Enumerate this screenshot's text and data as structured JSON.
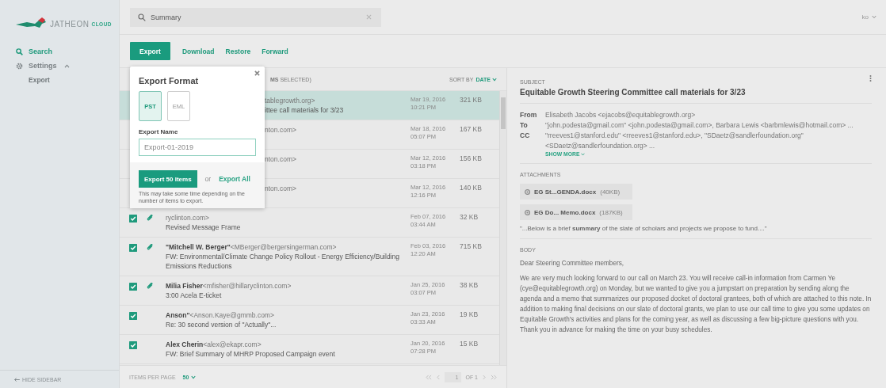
{
  "sidebar": {
    "logo": {
      "name": "JATHEON",
      "suffix": "CLOUD"
    },
    "nav": [
      {
        "kind": "search",
        "label": "Search",
        "selected": true
      },
      {
        "kind": "settings",
        "label": "Settings",
        "selected": false,
        "expanded": true,
        "children": [
          {
            "label": "Export",
            "selected": false
          }
        ]
      }
    ],
    "hide_sidebar": "HIDE SIDEBAR"
  },
  "search": {
    "value": "Summary"
  },
  "user": {
    "label": "ko"
  },
  "toolbar": [
    {
      "kind": "primary",
      "label": "Export"
    },
    {
      "kind": "link",
      "label": "Download"
    },
    {
      "kind": "link",
      "label": "Restore"
    },
    {
      "kind": "link",
      "label": "Forward"
    }
  ],
  "list": {
    "selection": "**MS** SELECTED)",
    "sort_label": "SORT BY",
    "sort_value": "DATE",
    "rows": [
      {
        "kind": "partial",
        "selected": true,
        "sender": "tablegrowth.org>",
        "subject": "ittee call materials for 3/23",
        "date": "Mar 19, 2016",
        "time": "10:21 PM",
        "size": "321 KB"
      },
      {
        "kind": "partial",
        "selected": false,
        "sender": "nton.com>",
        "date": "Mar 18, 2016",
        "time": "05:07 PM",
        "size": "167 KB"
      },
      {
        "kind": "partial",
        "selected": false,
        "sender": "nton.com>",
        "date": "Mar 12, 2016",
        "time": "03:18 PM",
        "size": "156 KB"
      },
      {
        "kind": "partial",
        "selected": false,
        "sender": "nton.com>",
        "date": "Mar 12, 2016",
        "time": "12:16 PM",
        "size": "140 KB"
      },
      {
        "kind": "full",
        "selected": false,
        "checked": true,
        "attachment": true,
        "email": "ryclinton.com>",
        "subject": "Revised Message Frame",
        "date": "Feb 07, 2016",
        "time": "03:44 AM",
        "size": "32 KB"
      },
      {
        "kind": "full",
        "selected": false,
        "checked": true,
        "attachment": true,
        "name": "\"Mitchell W. Berger\"",
        "email": "<MBerger@bergersingerman.com>",
        "subject": "FW: Environmental/Climate Change Policy Rollout - Energy Efficiency/Building Emissions Reductions",
        "date": "Feb 03, 2016",
        "time": "12:20 AM",
        "size": "715 KB"
      },
      {
        "kind": "full",
        "selected": false,
        "checked": true,
        "attachment": true,
        "name": "Milia Fisher",
        "email": "<mfisher@hillaryclinton.com>",
        "subject": "3:00 Acela E-ticket",
        "date": "Jan 25, 2016",
        "time": "03:07 PM",
        "size": "38 KB"
      },
      {
        "kind": "full",
        "selected": false,
        "checked": true,
        "attachment": false,
        "name": "Anson\"",
        "email": "<Anson.Kaye@gmmb.com>",
        "subject": "Re: 30 second version of \"Actually\"...",
        "date": "Jan 23, 2016",
        "time": "03:33 AM",
        "size": "19 KB"
      },
      {
        "kind": "full",
        "selected": false,
        "checked": true,
        "attachment": false,
        "name": "Alex Cherin",
        "email": "<alex@ekapr.com>",
        "subject": "FW: Brief Summary of MHRP Proposed Campaign event",
        "date": "Jan 20, 2016",
        "time": "07:28 PM",
        "size": "15 KB"
      }
    ],
    "footer": {
      "per_page_label": "ITEMS PER PAGE",
      "per_page_value": "50",
      "page": "1",
      "of": "OF 1"
    }
  },
  "popup": {
    "title": "Export Format",
    "formats": [
      {
        "label": "PST",
        "selected": true
      },
      {
        "label": "EML",
        "selected": false
      }
    ],
    "name_label": "Export Name",
    "name_value": "Export-01-2019",
    "primary": "Export 50 Items",
    "or": "or",
    "secondary": "Export All",
    "note": "This may take some time depending on the number of items to export."
  },
  "detail": {
    "subject_label": "SUBJECT",
    "subject": "Equitable Growth Steering Committee call materials for 3/23",
    "headers": [
      {
        "label": "From",
        "value": "Elisabeth Jacobs <ejacobs@equitablegrowth.org>"
      },
      {
        "label": "To",
        "value": "\"john.podesta@gmail.com\" <john.podesta@gmail.com>, Barbara Lewis <barbmlewis@hotmail.com> ..."
      },
      {
        "label": "CC",
        "value": "\"rreeves1@stanford.edu\" <rreeves1@stanford.edu>, \"SDaetz@sandlerfoundation.org\" <SDaetz@sandlerfoundation.org> ..."
      }
    ],
    "show_more": "SHOW MORE",
    "attachments_label": "ATTACHMENTS",
    "attachments": [
      {
        "name": "EG St...GENDA.docx",
        "size": "(40KB)"
      },
      {
        "name": "EG Do... Memo.docx",
        "size": "(187KB)"
      }
    ],
    "snippet": "\"...Below is a brief **summary** of the slate of scholars and projects we propose to fund....\"",
    "body_label": "BODY",
    "body": [
      "Dear Steering Committee members,",
      "We are very much looking forward to our call on March 23. You will receive call-in information from Carmen Ye (cye@equitablegrowth.org) on Monday, but we wanted to give you a jumpstart on preparation by sending along the agenda and a memo that summarizes our proposed docket of doctoral grantees, both of which are attached to this note. In addition to making final decisions on our slate of doctoral grants, we plan to use our call time to give you some updates on Equitable Growth's activities and plans for the coming year, as well as discussing a few big-picture questions with you. Thank you in advance for making the time on your busy schedules."
    ]
  }
}
